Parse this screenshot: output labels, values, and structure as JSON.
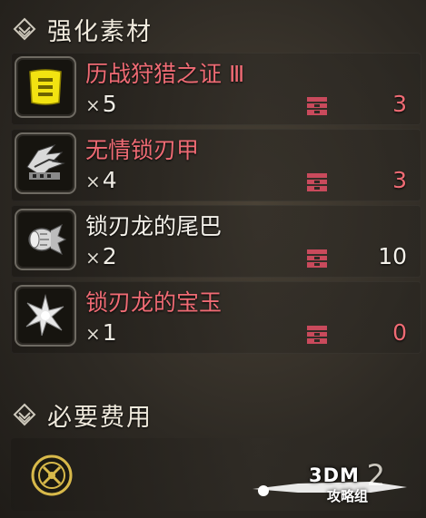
{
  "materials_section": {
    "title": "强化素材",
    "icon": "diamond-stack-icon"
  },
  "items": [
    {
      "name": "历战狩猎之证 Ⅲ",
      "quantity": "5",
      "owned": "3",
      "name_color": "red",
      "owned_color": "red",
      "icon": "certificate-icon"
    },
    {
      "name": "无情锁刃甲",
      "quantity": "4",
      "owned": "3",
      "name_color": "red",
      "owned_color": "red",
      "icon": "scale-shell-icon"
    },
    {
      "name": "锁刃龙的尾巴",
      "quantity": "2",
      "owned": "10",
      "name_color": "white",
      "owned_color": "white",
      "icon": "tail-icon"
    },
    {
      "name": "锁刃龙的宝玉",
      "quantity": "1",
      "owned": "0",
      "name_color": "red",
      "owned_color": "red",
      "icon": "gem-icon"
    }
  ],
  "qty_prefix": "×",
  "cost_section": {
    "title": "必要费用",
    "icon": "diamond-stack-icon"
  },
  "cost": {
    "value": "2",
    "icon": "zenny-coin-icon"
  },
  "watermark": {
    "line1": "3DM",
    "line2": "攻略组"
  },
  "colors": {
    "red_text": "#ef6b74",
    "white_text": "#f4f1ea",
    "box_icon": "#c94a5c"
  }
}
